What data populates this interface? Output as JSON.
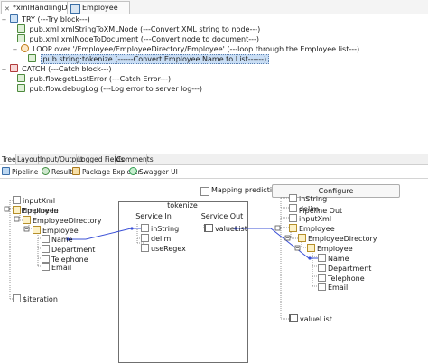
{
  "editor_tabs": [
    {
      "label": "*xmlHandlingDemo",
      "active": true,
      "closable": true
    },
    {
      "label": "Employee",
      "active": false,
      "closable": false
    }
  ],
  "flow": [
    {
      "expander": "−",
      "label": "TRY (---Try block---)",
      "icon": "try-icon"
    },
    {
      "expander": "",
      "label": "pub.xml:xmlStringToXMLNode (---Convert XML string to node---)",
      "icon": "invoke-icon"
    },
    {
      "expander": "",
      "label": "pub.xml:xmlNodeToDocument (---Convert node to document---)",
      "icon": "invoke-icon"
    },
    {
      "expander": "−",
      "label": "LOOP over '/Employee/EmployeeDirectory/Employee' (---loop through the Employee list---)",
      "icon": "loop-icon"
    },
    {
      "expander": "",
      "label": "pub.string:tokenize (------Convert Employee Name to List------)",
      "icon": "invoke-icon",
      "selected": true
    },
    {
      "expander": "−",
      "label": "CATCH (---Catch block---)",
      "icon": "catch-icon"
    },
    {
      "expander": "",
      "label": "pub.flow:getLastError (---Catch Error---)",
      "icon": "invoke-icon"
    },
    {
      "expander": "",
      "label": "pub.flow:debugLog (---Log error to server log---)",
      "icon": "invoke-icon"
    }
  ],
  "bottom_tabs": [
    "Tree",
    "Layout",
    "Input/Output",
    "Logged Fields",
    "Comments"
  ],
  "view_tabs": [
    {
      "label": "Pipeline",
      "icon": "pipeline-icon"
    },
    {
      "label": "Results",
      "icon": "results-icon"
    },
    {
      "label": "Package Explorer",
      "icon": "package-icon"
    },
    {
      "label": "Swagger UI",
      "icon": "swagger-icon"
    }
  ],
  "mapping": {
    "service_title": "tokenize",
    "mapping_predictions_label": "Mapping predictions",
    "mapping_predictions_checked": false,
    "configure_label": "Configure",
    "pipeline_in_title": "Pipeline In",
    "service_in_title": "Service In",
    "service_out_title": "Service Out",
    "pipeline_out_title": "Pipeline Out",
    "pipeline_in": [
      {
        "label": "inputXml",
        "type": "str"
      },
      {
        "label": "Employee",
        "type": "doc"
      },
      {
        "label": "EmployeeDirectory",
        "type": "doc"
      },
      {
        "label": "Employee",
        "type": "doc"
      },
      {
        "label": "Name",
        "type": "str"
      },
      {
        "label": "Department",
        "type": "str"
      },
      {
        "label": "Telephone",
        "type": "str"
      },
      {
        "label": "Email",
        "type": "str"
      },
      {
        "label": "$iteration",
        "type": "str"
      }
    ],
    "service_in": [
      {
        "label": "inString",
        "type": "str"
      },
      {
        "label": "delim",
        "type": "str"
      },
      {
        "label": "useRegex",
        "type": "str"
      }
    ],
    "service_out": [
      {
        "label": "valueList",
        "type": "list"
      }
    ],
    "pipeline_out": [
      {
        "label": "inString",
        "type": "str"
      },
      {
        "label": "delim",
        "type": "str"
      },
      {
        "label": "inputXml",
        "type": "str"
      },
      {
        "label": "Employee",
        "type": "doc"
      },
      {
        "label": "EmployeeDirectory",
        "type": "doc"
      },
      {
        "label": "Employee",
        "type": "doc"
      },
      {
        "label": "Name",
        "type": "str"
      },
      {
        "label": "Department",
        "type": "str"
      },
      {
        "label": "Telephone",
        "type": "str"
      },
      {
        "label": "Email",
        "type": "str"
      },
      {
        "label": "valueList",
        "type": "list"
      }
    ]
  },
  "colors": {
    "selection": "#c9def5",
    "link_line": "#3b50d6",
    "tree_line": "#7a7a7a"
  }
}
